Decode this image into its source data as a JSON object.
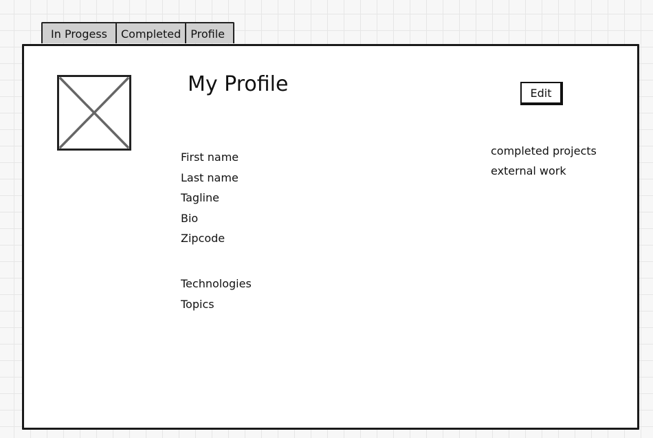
{
  "tabs": [
    {
      "label": "In Progess",
      "active": false
    },
    {
      "label": "Completed",
      "active": false
    },
    {
      "label": "Profile",
      "active": true
    }
  ],
  "profile": {
    "title": "My Profile",
    "edit_label": "Edit",
    "avatar_icon": "image-placeholder-icon",
    "fields": [
      "First name",
      "Last name",
      "Tagline",
      "Bio",
      "Zipcode"
    ],
    "extra_fields": [
      "Technologies",
      "Topics"
    ],
    "side_links": [
      "completed projects",
      "external work"
    ]
  },
  "colors": {
    "tab_background": "#cfcfcf",
    "panel_border": "#1a1a1a",
    "placeholder_cross": "#666666"
  }
}
